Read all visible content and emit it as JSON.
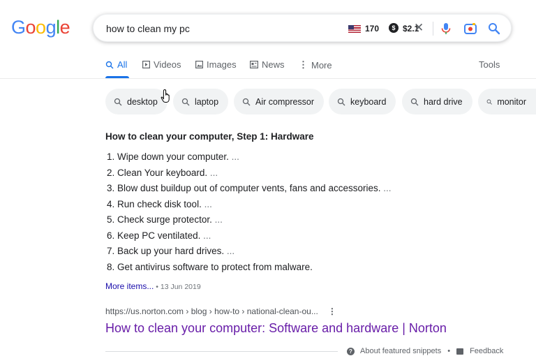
{
  "logo": {
    "letters": [
      "G",
      "o",
      "o",
      "g",
      "l",
      "e"
    ],
    "colors": [
      "#4285f4",
      "#ea4335",
      "#fbbc05",
      "#4285f4",
      "#34a853",
      "#ea4335"
    ]
  },
  "search": {
    "query": "how to clean my pc"
  },
  "extension": {
    "flag": "us-flag-icon",
    "count": "170",
    "coin_symbol": "$",
    "amount": "$2.1"
  },
  "icons": {
    "clear": "close-icon",
    "mic": "mic-icon",
    "lens": "camera-lens-icon",
    "search": "search-icon"
  },
  "tabs": [
    {
      "label": "All",
      "icon": "search-icon",
      "active": true
    },
    {
      "label": "Videos",
      "icon": "play-icon"
    },
    {
      "label": "Images",
      "icon": "image-icon"
    },
    {
      "label": "News",
      "icon": "news-icon"
    },
    {
      "label": "More",
      "icon": "more-vert-icon"
    }
  ],
  "tools_label": "Tools",
  "chips": [
    "desktop",
    "laptop",
    "Air compressor",
    "keyboard",
    "hard drive",
    "monitor"
  ],
  "snippet": {
    "title": "How to clean your computer, Step 1: Hardware",
    "steps": [
      "1. Wipe down your computer.",
      "2. Clean Your keyboard.",
      "3. Blow dust buildup out of computer vents, fans and accessories.",
      "4. Run check disk tool.",
      "5. Check surge protector.",
      "6. Keep PC ventilated.",
      "7. Back up your hard drives.",
      "8. Get antivirus software to protect from malware."
    ],
    "ellipsis": " ...",
    "more_items": "More items...",
    "date": " • 13 Jun 2019"
  },
  "result": {
    "url": "https://us.norton.com › blog › how-to › national-clean-ou...",
    "title": "How to clean your computer: Software and hardware | Norton"
  },
  "footer": {
    "about": "About featured snippets",
    "sep": "•",
    "feedback": "Feedback"
  },
  "colors": {
    "accent": "#1a73e8",
    "visited_link": "#681da8",
    "link": "#1a0dab"
  }
}
